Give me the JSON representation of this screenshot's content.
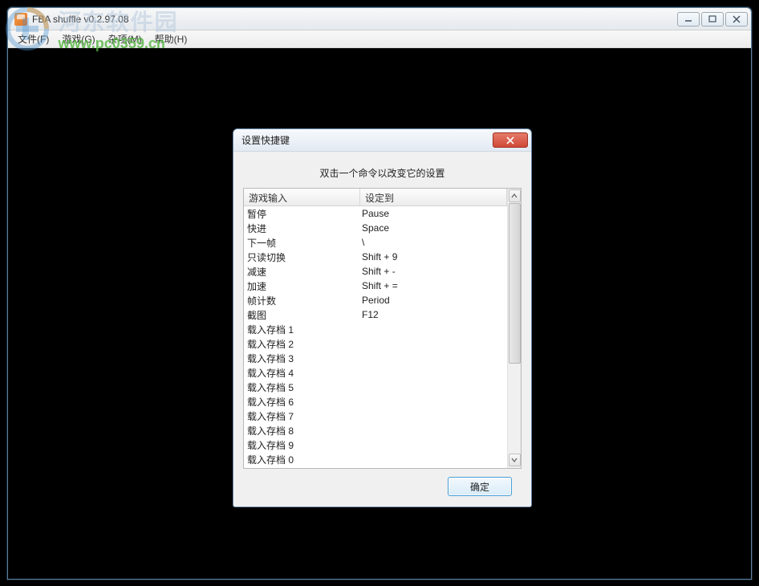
{
  "watermark": {
    "title": "河东软件园",
    "url": "www.pc0359.cn"
  },
  "mainWindow": {
    "title": "FBA shuffle v0.2.97.08",
    "menu": {
      "file": "文件(F)",
      "game": "游戏(G)",
      "misc": "杂项(M)",
      "help": "帮助(H)"
    }
  },
  "dialog": {
    "title": "设置快捷键",
    "instruction": "双击一个命令以改变它的设置",
    "columns": {
      "input": "游戏输入",
      "setTo": "设定到"
    },
    "rows": [
      {
        "name": "暂停",
        "key": "Pause"
      },
      {
        "name": "快进",
        "key": "Space"
      },
      {
        "name": "下一帧",
        "key": "\\"
      },
      {
        "name": "只读切换",
        "key": "Shift + 9"
      },
      {
        "name": "减速",
        "key": "Shift + -"
      },
      {
        "name": "加速",
        "key": "Shift + ="
      },
      {
        "name": "帧计数",
        "key": "Period"
      },
      {
        "name": "截图",
        "key": "F12"
      },
      {
        "name": "载入存档 1",
        "key": ""
      },
      {
        "name": "载入存档 2",
        "key": ""
      },
      {
        "name": "载入存档 3",
        "key": ""
      },
      {
        "name": "载入存档 4",
        "key": ""
      },
      {
        "name": "载入存档 5",
        "key": ""
      },
      {
        "name": "载入存档 6",
        "key": ""
      },
      {
        "name": "载入存档 7",
        "key": ""
      },
      {
        "name": "载入存档 8",
        "key": ""
      },
      {
        "name": "载入存档 9",
        "key": ""
      },
      {
        "name": "载入存档 0",
        "key": ""
      }
    ],
    "okButton": "确定"
  }
}
